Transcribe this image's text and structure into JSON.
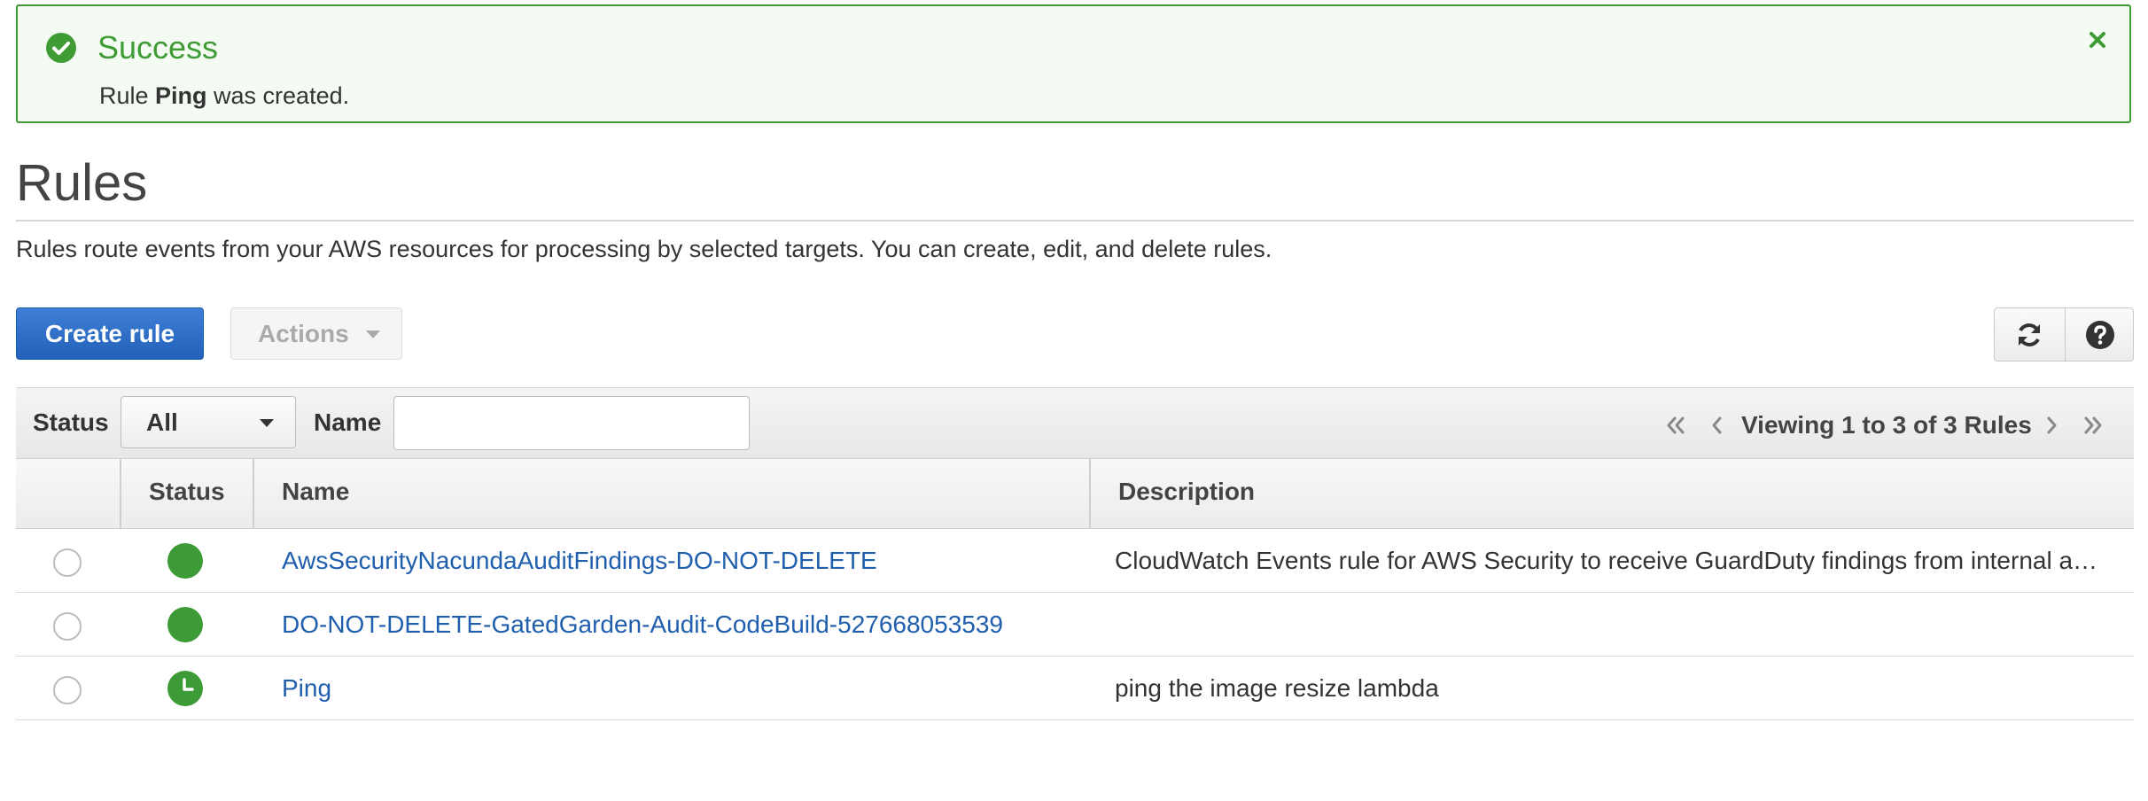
{
  "banner": {
    "title": "Success",
    "message_prefix": "Rule ",
    "message_rule": "Ping",
    "message_suffix": " was created.",
    "color": "#3f9c35"
  },
  "page": {
    "title": "Rules",
    "description": "Rules route events from your AWS resources for processing by selected targets. You can create, edit, and delete rules."
  },
  "toolbar": {
    "create_label": "Create rule",
    "actions_label": "Actions"
  },
  "filters": {
    "status_label": "Status",
    "status_value": "All",
    "name_label": "Name",
    "name_value": "",
    "name_placeholder": ""
  },
  "pagination": {
    "text": "Viewing 1 to 3 of 3 Rules"
  },
  "table": {
    "columns": [
      "Status",
      "Name",
      "Description"
    ],
    "rows": [
      {
        "status": "enabled",
        "name": "AwsSecurityNacundaAuditFindings-DO-NOT-DELETE",
        "description": "CloudWatch Events rule for AWS Security to receive GuardDuty findings from internal a…"
      },
      {
        "status": "enabled",
        "name": "DO-NOT-DELETE-GatedGarden-Audit-CodeBuild-527668053539",
        "description": ""
      },
      {
        "status": "scheduled",
        "name": "Ping",
        "description": "ping the image resize lambda"
      }
    ]
  },
  "colors": {
    "primary_button": "#2261b9",
    "link": "#1f5fae",
    "status_green": "#3c9a37"
  }
}
